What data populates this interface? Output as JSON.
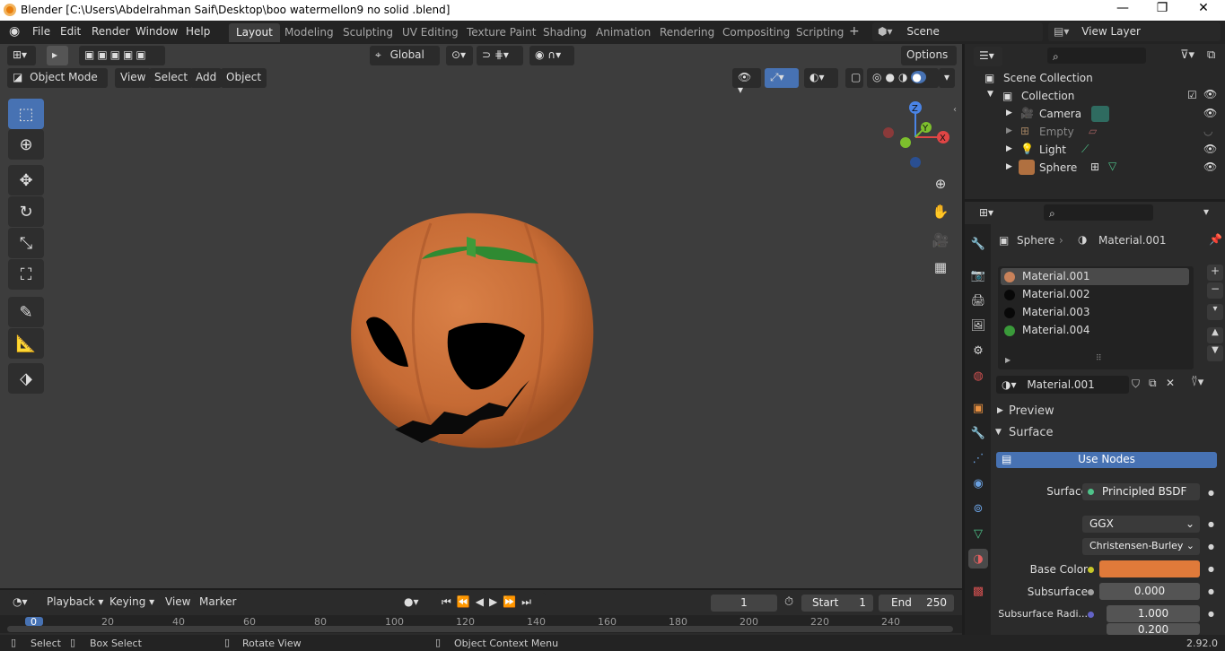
{
  "window": {
    "title": "Blender [C:\\Users\\Abdelrahman Saif\\Desktop\\boo watermellon9 no solid .blend]",
    "minimize": "—",
    "maximize": "❐",
    "close": "✕"
  },
  "menu": [
    "File",
    "Edit",
    "Render",
    "Window",
    "Help"
  ],
  "workspaces": [
    "Layout",
    "Modeling",
    "Sculpting",
    "UV Editing",
    "Texture Paint",
    "Shading",
    "Animation",
    "Rendering",
    "Compositing",
    "Scripting"
  ],
  "scene": {
    "label": "Scene",
    "view_layer": "View Layer"
  },
  "viewport": {
    "mode": "Object Mode",
    "menus": [
      "View",
      "Select",
      "Add",
      "Object"
    ],
    "transform_orientation": "Global",
    "options": "Options",
    "gizmo": {
      "x": "X",
      "y": "Y",
      "z": "Z"
    }
  },
  "outliner": {
    "scene_collection": "Scene Collection",
    "collection": "Collection",
    "items": [
      {
        "name": "Camera",
        "icon": "camera-icon"
      },
      {
        "name": "Empty",
        "icon": "empty-icon"
      },
      {
        "name": "Light",
        "icon": "light-icon"
      },
      {
        "name": "Sphere",
        "icon": "mesh-icon"
      }
    ]
  },
  "properties": {
    "object": "Sphere",
    "material": "Material.001",
    "slots": [
      {
        "name": "Material.001",
        "color": "#c9825a"
      },
      {
        "name": "Material.002",
        "color": "#080808"
      },
      {
        "name": "Material.003",
        "color": "#080808"
      },
      {
        "name": "Material.004",
        "color": "#3a9a3a"
      }
    ],
    "material_field": "Material.001",
    "preview": "Preview",
    "surface": "Surface",
    "use_nodes": "Use Nodes",
    "surface_label": "Surface",
    "shader": "Principled BSDF",
    "distribution": "GGX",
    "subsurface_method": "Christensen-Burley",
    "base_color_label": "Base Color",
    "base_color": "#e07a3a",
    "subsurface_label": "Subsurface",
    "subsurface": "0.000",
    "subsurface_radius_label": "Subsurface Radi...",
    "subsurface_radius": "1.000",
    "subsurface_radius_2": "0.200"
  },
  "timeline": {
    "menus": [
      "Playback",
      "Keying",
      "View",
      "Marker"
    ],
    "current_frame": "1",
    "start_label": "Start",
    "start": "1",
    "end_label": "End",
    "end": "250",
    "ticks": [
      "0",
      "20",
      "40",
      "60",
      "80",
      "100",
      "120",
      "140",
      "160",
      "180",
      "200",
      "220",
      "240"
    ]
  },
  "status": {
    "select": "Select",
    "box_select": "Box Select",
    "rotate_view": "Rotate View",
    "context_menu": "Object Context Menu",
    "version": "2.92.0"
  }
}
